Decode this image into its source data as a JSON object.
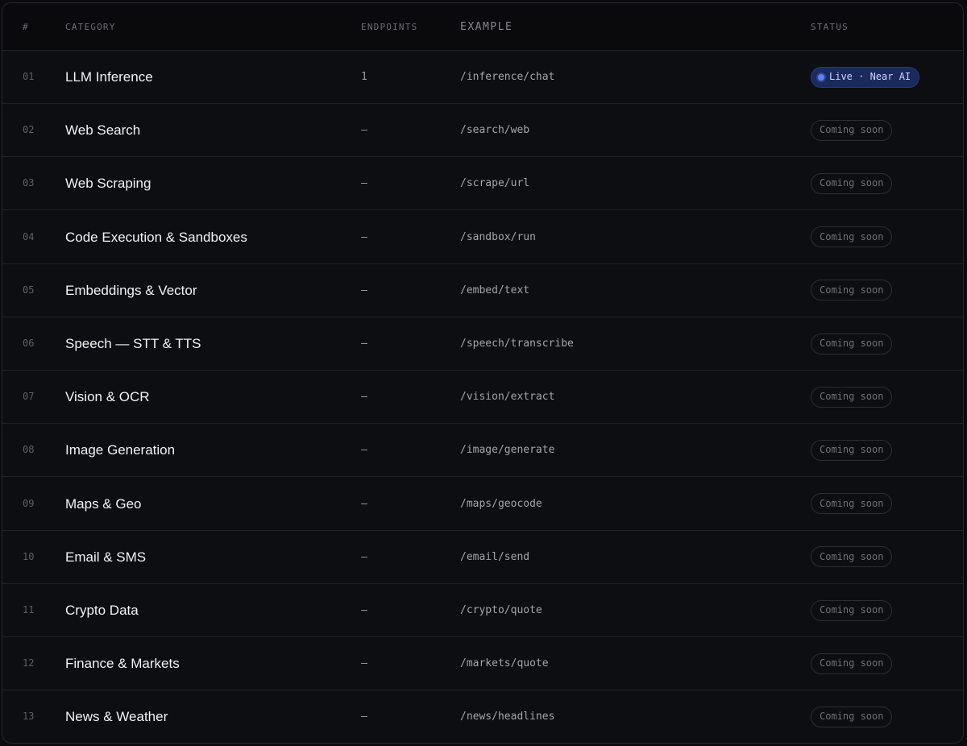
{
  "header": {
    "num": "#",
    "category": "CATEGORY",
    "endpoints": "ENDPOINTS",
    "example": "EXAMPLE",
    "status": "STATUS"
  },
  "colors": {
    "live_badge_bg": "#1a2a5c",
    "live_dot": "#5b82f0",
    "panel_bg": "#0d0e11"
  },
  "rows": [
    {
      "num": "01",
      "category": "LLM Inference",
      "endpoints": "1",
      "example": "/inference/chat",
      "status": "Live · Near AI",
      "live": true
    },
    {
      "num": "02",
      "category": "Web Search",
      "endpoints": "—",
      "example": "/search/web",
      "status": "Coming soon",
      "live": false
    },
    {
      "num": "03",
      "category": "Web Scraping",
      "endpoints": "—",
      "example": "/scrape/url",
      "status": "Coming soon",
      "live": false
    },
    {
      "num": "04",
      "category": "Code Execution & Sandboxes",
      "endpoints": "—",
      "example": "/sandbox/run",
      "status": "Coming soon",
      "live": false
    },
    {
      "num": "05",
      "category": "Embeddings & Vector",
      "endpoints": "—",
      "example": "/embed/text",
      "status": "Coming soon",
      "live": false
    },
    {
      "num": "06",
      "category": "Speech — STT & TTS",
      "endpoints": "—",
      "example": "/speech/transcribe",
      "status": "Coming soon",
      "live": false
    },
    {
      "num": "07",
      "category": "Vision & OCR",
      "endpoints": "—",
      "example": "/vision/extract",
      "status": "Coming soon",
      "live": false
    },
    {
      "num": "08",
      "category": "Image Generation",
      "endpoints": "—",
      "example": "/image/generate",
      "status": "Coming soon",
      "live": false
    },
    {
      "num": "09",
      "category": "Maps & Geo",
      "endpoints": "—",
      "example": "/maps/geocode",
      "status": "Coming soon",
      "live": false
    },
    {
      "num": "10",
      "category": "Email & SMS",
      "endpoints": "—",
      "example": "/email/send",
      "status": "Coming soon",
      "live": false
    },
    {
      "num": "11",
      "category": "Crypto Data",
      "endpoints": "—",
      "example": "/crypto/quote",
      "status": "Coming soon",
      "live": false
    },
    {
      "num": "12",
      "category": "Finance & Markets",
      "endpoints": "—",
      "example": "/markets/quote",
      "status": "Coming soon",
      "live": false
    },
    {
      "num": "13",
      "category": "News & Weather",
      "endpoints": "—",
      "example": "/news/headlines",
      "status": "Coming soon",
      "live": false
    }
  ]
}
